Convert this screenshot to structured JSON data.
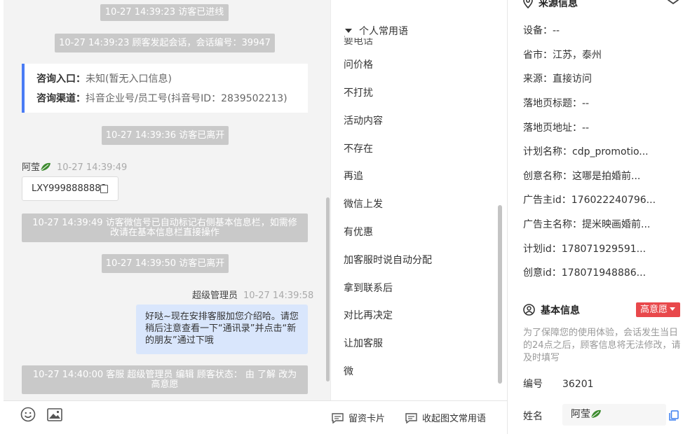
{
  "chat": {
    "sys1": "10-27 14:39:23 访客已进线",
    "sys2": "10-27 14:39:23 顾客发起会话，会话编号：39947",
    "entry": {
      "entry_label": "咨询入口：",
      "entry_value": "未知(暂无入口信息)",
      "channel_label": "咨询渠道：",
      "channel_value": "抖音企业号/员工号(抖音号ID：2839502213)"
    },
    "sys3": "10-27 14:39:36 访客已离开",
    "visitor_name": "阿莹",
    "visitor_time": "10-27 14:39:49",
    "wechat_id": "LXY9998888888",
    "sys4": "10-27 14:39:49 访客微信号已自动标记右侧基本信息栏，如需修改请在基本信息栏直接操作",
    "sys5": "10-27 14:39:50 访客已离开",
    "agent_name": "超级管理员",
    "agent_time": "10-27 14:39:58",
    "agent_message": "好哒~现在安排客服加您介绍哈。请您稍后注意查看一下“通讯录”并点击“新的朋友”通过下哦",
    "sys6": "10-27 14:40:00 客服 超级管理员 编辑 顾客状态： 由 了解 改为 高意愿"
  },
  "toolbar": {
    "emoji_icon": "smiley-icon",
    "image_icon": "image-icon",
    "lead_card": "留资卡片",
    "collapse_phrases": "收起图文常用语"
  },
  "phrases": {
    "header": "个人常用语",
    "clipped_item": "要电话",
    "items": [
      "问价格",
      "不打扰",
      "活动内容",
      "不存在",
      "再追",
      "微信上发",
      "有优惠",
      "加客服时说自动分配",
      "拿到联系后",
      "对比再决定",
      "让加客服",
      "微"
    ]
  },
  "source": {
    "title": "来源信息",
    "device": "设备：--",
    "region": "省市：江苏，泰州",
    "origin": "来源：直接访问",
    "landing_title": "落地页标题：--",
    "landing_url": "落地页地址：--",
    "plan_name": "计划名称：cdp_promotio...",
    "creative_name": "创意名称：这哪是拍婚前...",
    "advertiser_id": "广告主id：176022240796...",
    "advertiser_name": "广告主名称：提米映画婚前...",
    "plan_id": "计划id：178071929591...",
    "creative_id": "创意id：178071948886..."
  },
  "basic": {
    "title": "基本信息",
    "status_badge": "高意愿",
    "note": "为了保障您的使用体验，会话发生当日的24点之后，顾客信息将无法修改，请及时填写",
    "id_label": "编号",
    "id_value": "36201",
    "name_label": "姓名",
    "name_value": "阿莹"
  },
  "colors": {
    "accent_blue": "#4a7cf5",
    "badge_red": "#e8484b",
    "agent_bubble": "#d9e6fc",
    "system_msg": "#c9c9c9"
  }
}
